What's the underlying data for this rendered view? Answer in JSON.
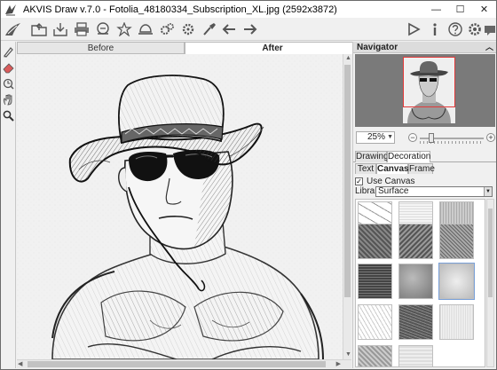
{
  "window": {
    "title": "AKVIS Draw v.7.0 - Fotolia_48180334_Subscription_XL.jpg (2592x3872)",
    "minimize": "—",
    "maximize": "☐",
    "close": "✕"
  },
  "toolbar": {
    "icons": [
      "open-icon",
      "save-icon",
      "print-icon",
      "share-icon",
      "presets-icon",
      "batch-icon",
      "settings-gear-icon",
      "gear-icon",
      "brush-icon",
      "undo-arrow-icon",
      "redo-arrow-icon",
      "run-icon",
      "info-icon",
      "help-icon",
      "preferences-icon",
      "comment-icon"
    ]
  },
  "left_tools": [
    "pencil-icon",
    "eraser-icon",
    "history-brush-icon",
    "hand-icon",
    "zoom-icon"
  ],
  "view_tabs": {
    "before": "Before",
    "after": "After"
  },
  "navigator": {
    "title": "Navigator",
    "zoom": "25%",
    "zoom_level_fraction": 0.18
  },
  "panel": {
    "tabs": [
      "Drawing",
      "Decoration"
    ],
    "active_tab": "Decoration",
    "subtabs": [
      "Text",
      "Canvas",
      "Frame"
    ],
    "active_subtab": "Canvas",
    "use_canvas_label": "Use Canvas",
    "use_canvas_checked": true,
    "library_label": "Library",
    "library_value": "Surface"
  },
  "colors": {
    "selection_frame": "#e23a3a",
    "navigator_bg": "#7a7a7a"
  }
}
